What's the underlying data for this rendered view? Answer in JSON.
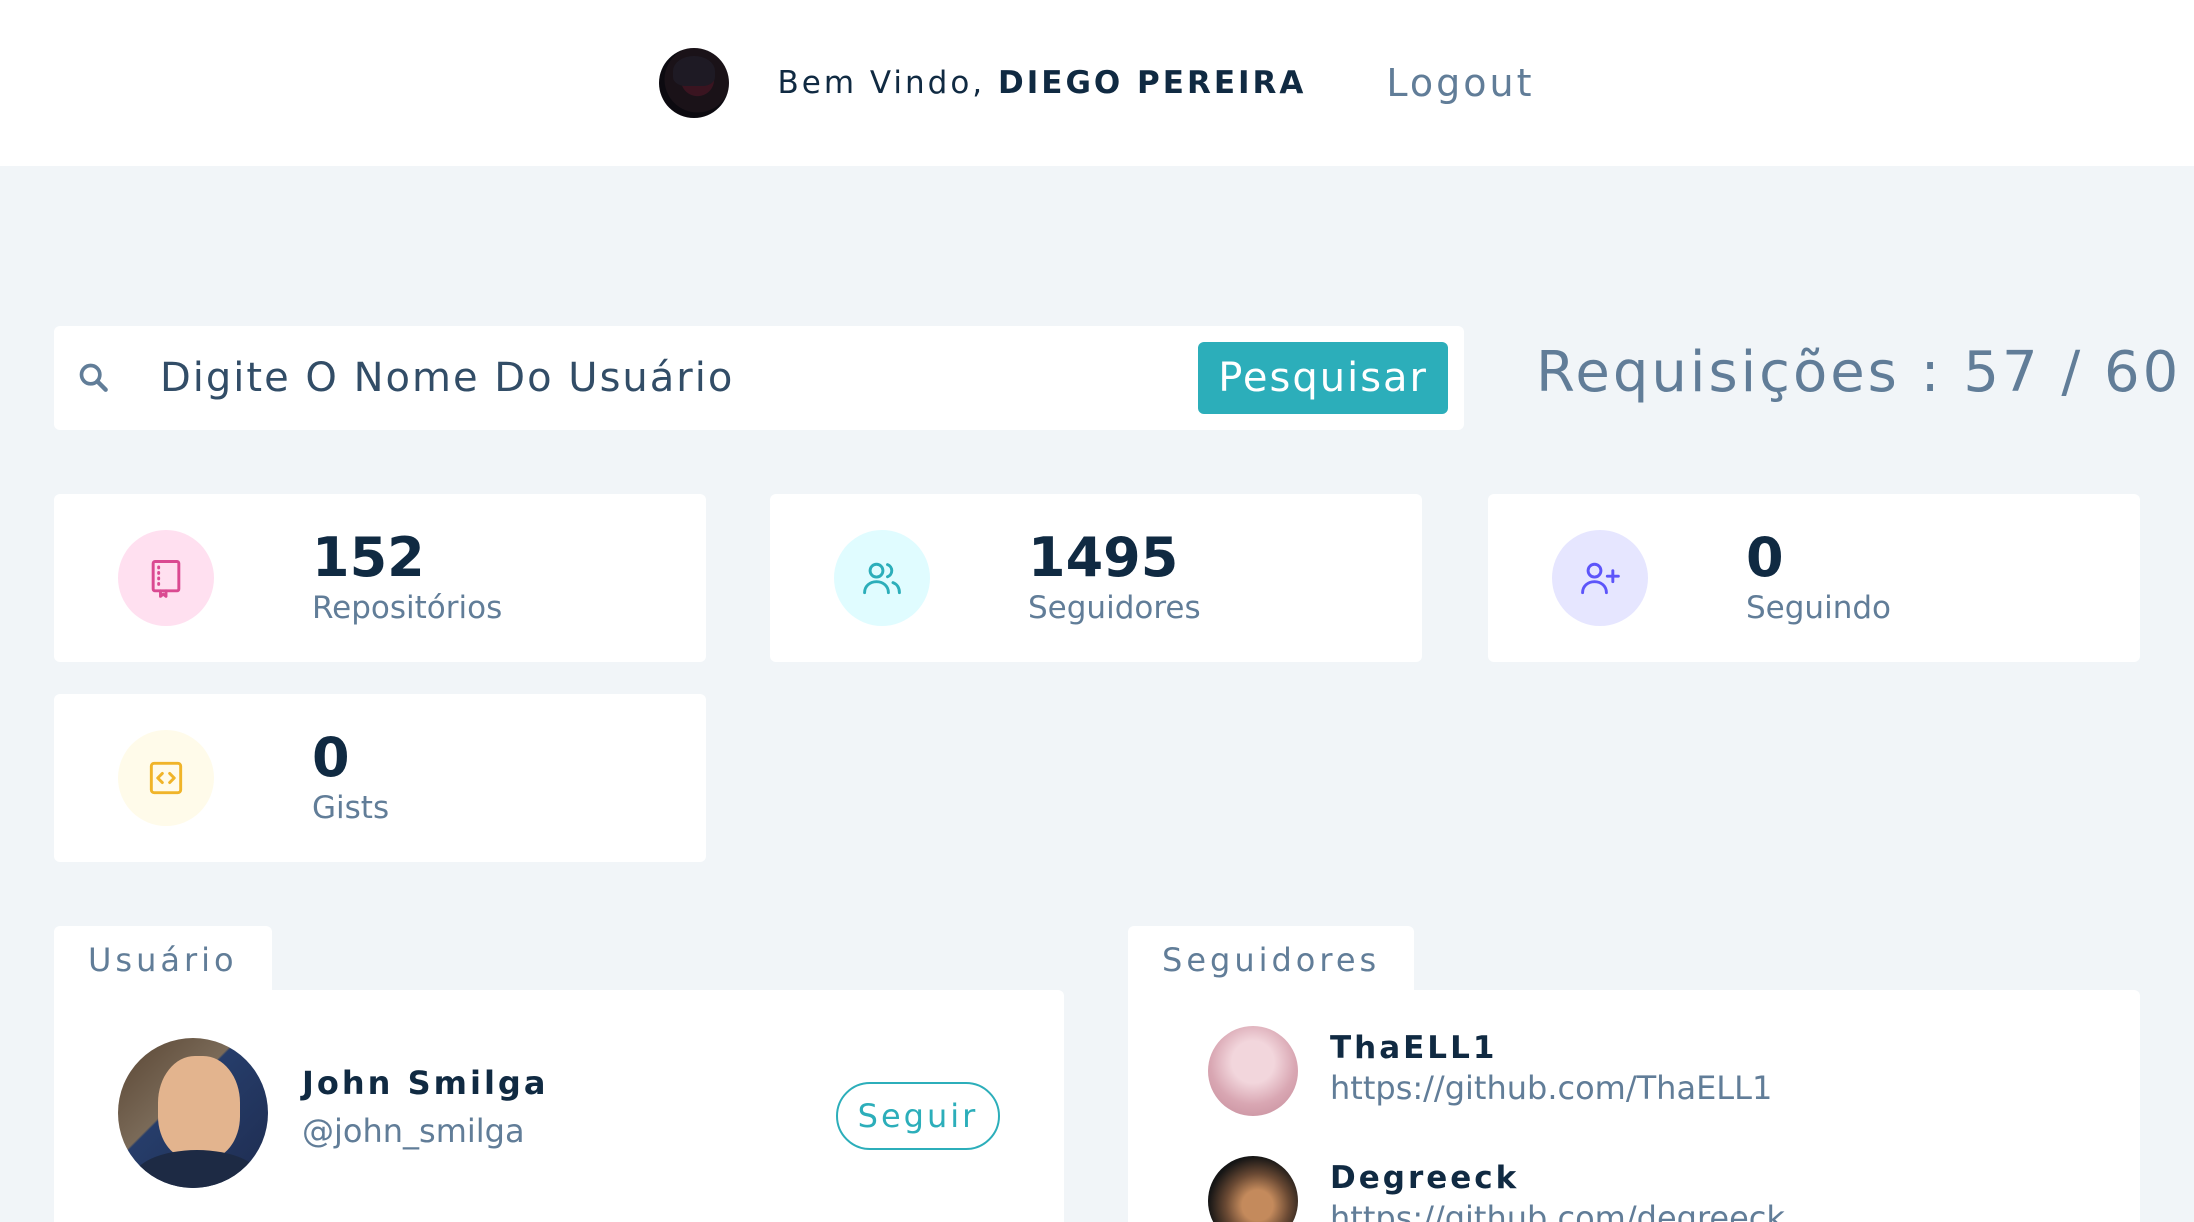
{
  "navbar": {
    "welcome_prefix": "Bem Vindo, ",
    "user_name": "DIEGO PEREIRA",
    "logout_label": "Logout"
  },
  "search": {
    "placeholder": "Digite O Nome Do Usuário",
    "button_label": "Pesquisar",
    "requests": "Requisições : 57 / 60"
  },
  "stats": [
    {
      "value": "152",
      "label": "Repositórios",
      "icon": "book-icon",
      "color": "#da4a91",
      "bg": "#ffe0f0"
    },
    {
      "value": "1495",
      "label": "Seguidores",
      "icon": "users-icon",
      "color": "#2caeba",
      "bg": "#e0fcff"
    },
    {
      "value": "0",
      "label": "Seguindo",
      "icon": "user-plus-icon",
      "color": "#5d55fa",
      "bg": "#e6e6ff"
    },
    {
      "value": "0",
      "label": "Gists",
      "icon": "code-icon",
      "color": "#f0b429",
      "bg": "#fffbea"
    }
  ],
  "user_panel": {
    "tab_label": "Usuário",
    "name": "John Smilga",
    "handle": "@john_smilga",
    "follow_label": "Seguir"
  },
  "followers_panel": {
    "tab_label": "Seguidores",
    "items": [
      {
        "name": "ThaELL1",
        "url": "https://github.com/ThaELL1"
      },
      {
        "name": "Degreeck",
        "url": "https://github.com/degreeck"
      }
    ]
  }
}
